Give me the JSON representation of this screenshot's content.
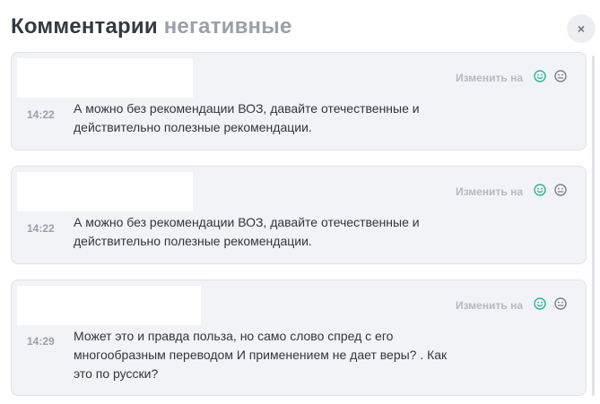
{
  "header": {
    "title": "Комментарии",
    "subtitle": "негативные",
    "close_icon": "×"
  },
  "comments": [
    {
      "time": "14:22",
      "text": "А можно без рекомендации ВОЗ, давайте отечественные и действительно полезные рекомендации.",
      "change_label": "Изменить на"
    },
    {
      "time": "14:22",
      "text": "А можно без рекомендации ВОЗ, давайте отечественные и действительно полезные рекомендации.",
      "change_label": "Изменить на"
    },
    {
      "time": "14:29",
      "text": "Может это и правда польза, но само слово спред с его многообразным переводом И применением не дает веры? . Как это по русски?",
      "change_label": "Изменить на"
    }
  ],
  "icons": {
    "positive": "smile-icon",
    "neutral": "neutral-face-icon",
    "close": "close-icon"
  },
  "colors": {
    "positive_accent": "#2bb39a",
    "neutral_icon": "#7a8089",
    "card_background": "#f2f3f6",
    "title": "#333a42",
    "subtitle": "#9aa1aa"
  }
}
